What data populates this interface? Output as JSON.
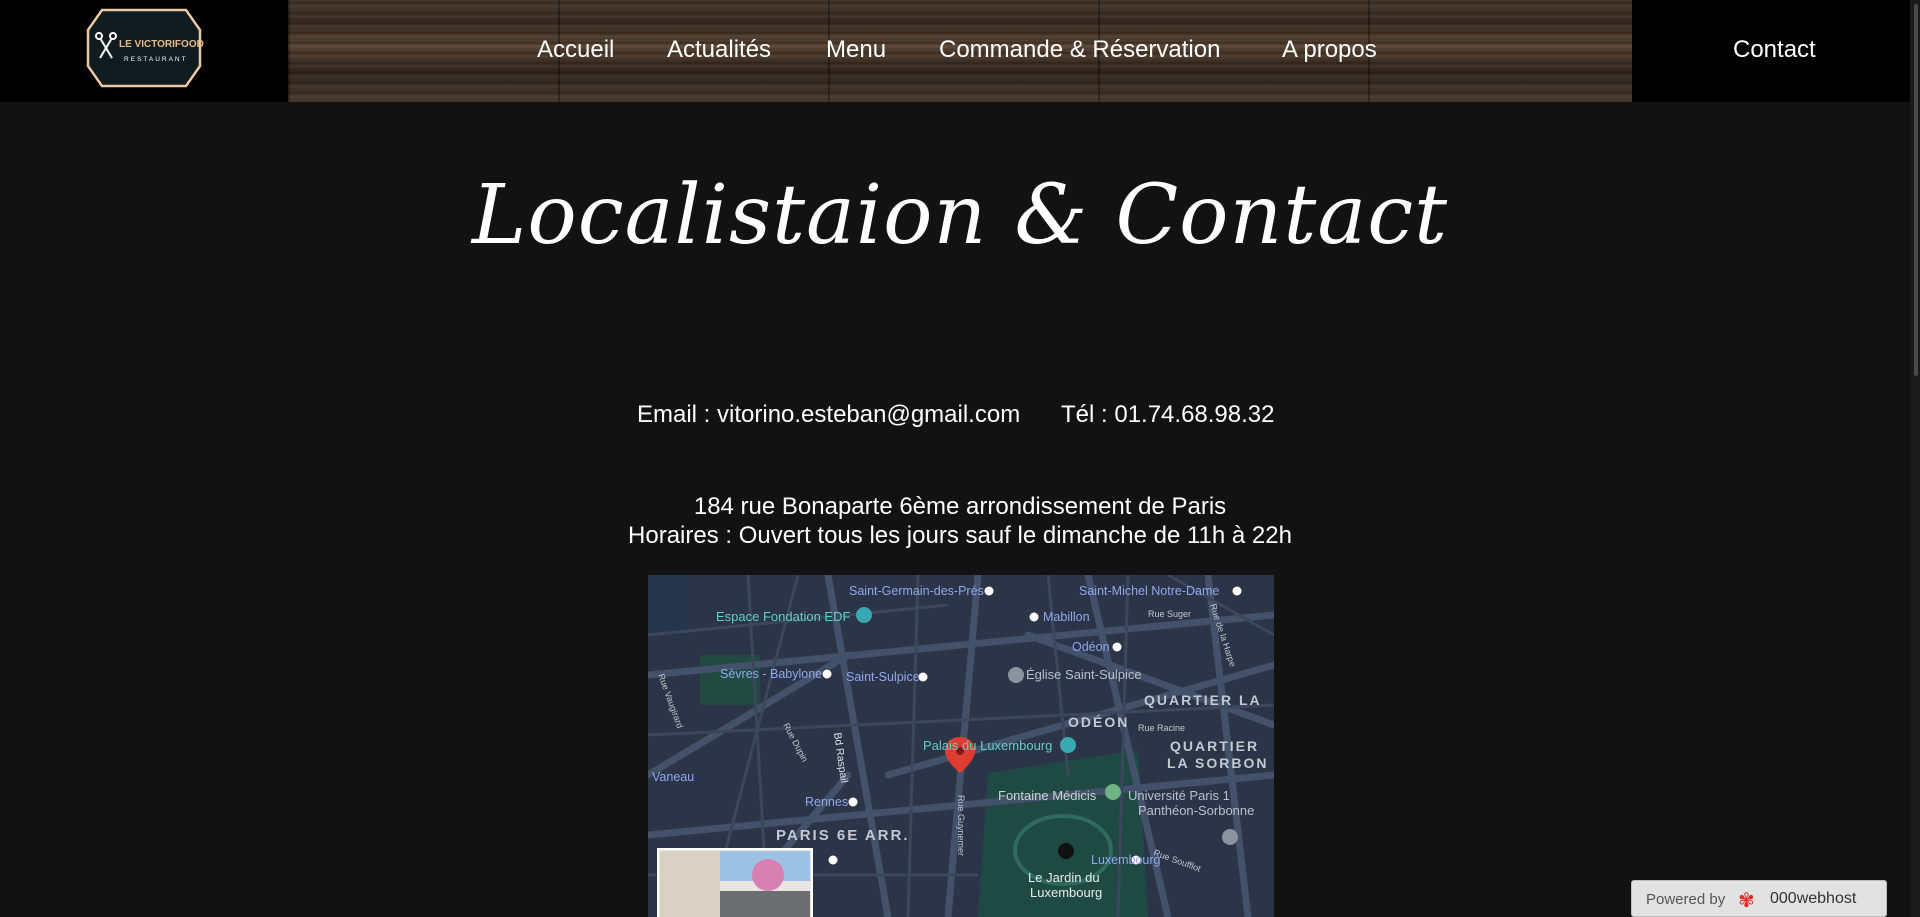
{
  "brand": {
    "line1": "LE VICTORIFOOD",
    "line2": "RESTAURANT"
  },
  "nav": {
    "accueil": "Accueil",
    "actualites": "Actualités",
    "menu": "Menu",
    "commande": "Commande & Réservation",
    "apropos": "A propos",
    "contact": "Contact"
  },
  "page": {
    "title": "Localistaion & Contact",
    "email": "Email : vitorino.esteban@gmail.com",
    "phone": "Tél : 01.74.68.98.32",
    "address": "184 rue Bonaparte 6ème arrondissement de Paris",
    "hours": "Horaires : Ouvert tous les jours sauf le dimanche de 11h à 22h"
  },
  "map": {
    "labels": {
      "saint_germain": "Saint-Germain-des-Prés",
      "espace_edf": "Espace Fondation EDF",
      "mabillon": "Mabillon",
      "saint_michel": "Saint-Michel Notre-Dame",
      "rue_suger": "Rue Suger",
      "odeon_station": "Odéon",
      "sevres": "Sèvres - Babylone",
      "saint_sulpice": "Saint-Sulpice",
      "eglise": "Église Saint-Sulpice",
      "quartier_la": "QUARTIER LA",
      "odeon_area": "ODÉON",
      "rue_racine": "Rue Racine",
      "quartier_sorbonne1": "QUARTIER",
      "quartier_sorbonne2": "LA SORBON",
      "palais": "Palais du Luxembourg",
      "vaneau": "Vaneau",
      "rennes": "Rennes",
      "fontaine": "Fontaine Médicis",
      "universite1": "Université Paris 1",
      "universite2": "Panthéon-Sorbonne",
      "paris6": "PARIS 6E ARR.",
      "luxembourg_station": "Luxembourg",
      "jardin1": "Le Jardin du",
      "jardin2": "Luxembourg",
      "rue_soufflot": "Rue Soufflot",
      "rue_vaugirard": "Rue Vaugirard",
      "rue_dupin": "Rue Dupin",
      "bd_raspail": "Bd Raspail",
      "rue_guynemer": "Rue Guynemer",
      "rue_harpe": "Rue de la Harpe"
    }
  },
  "footer": {
    "powered": "Powered by",
    "host": "000webhost"
  },
  "colors": {
    "background": "#121212",
    "header": "#000000",
    "map_bg": "#2c3547",
    "map_park": "#1f4a44",
    "map_marker": "#e03c31",
    "metro": "#7b9df5"
  }
}
